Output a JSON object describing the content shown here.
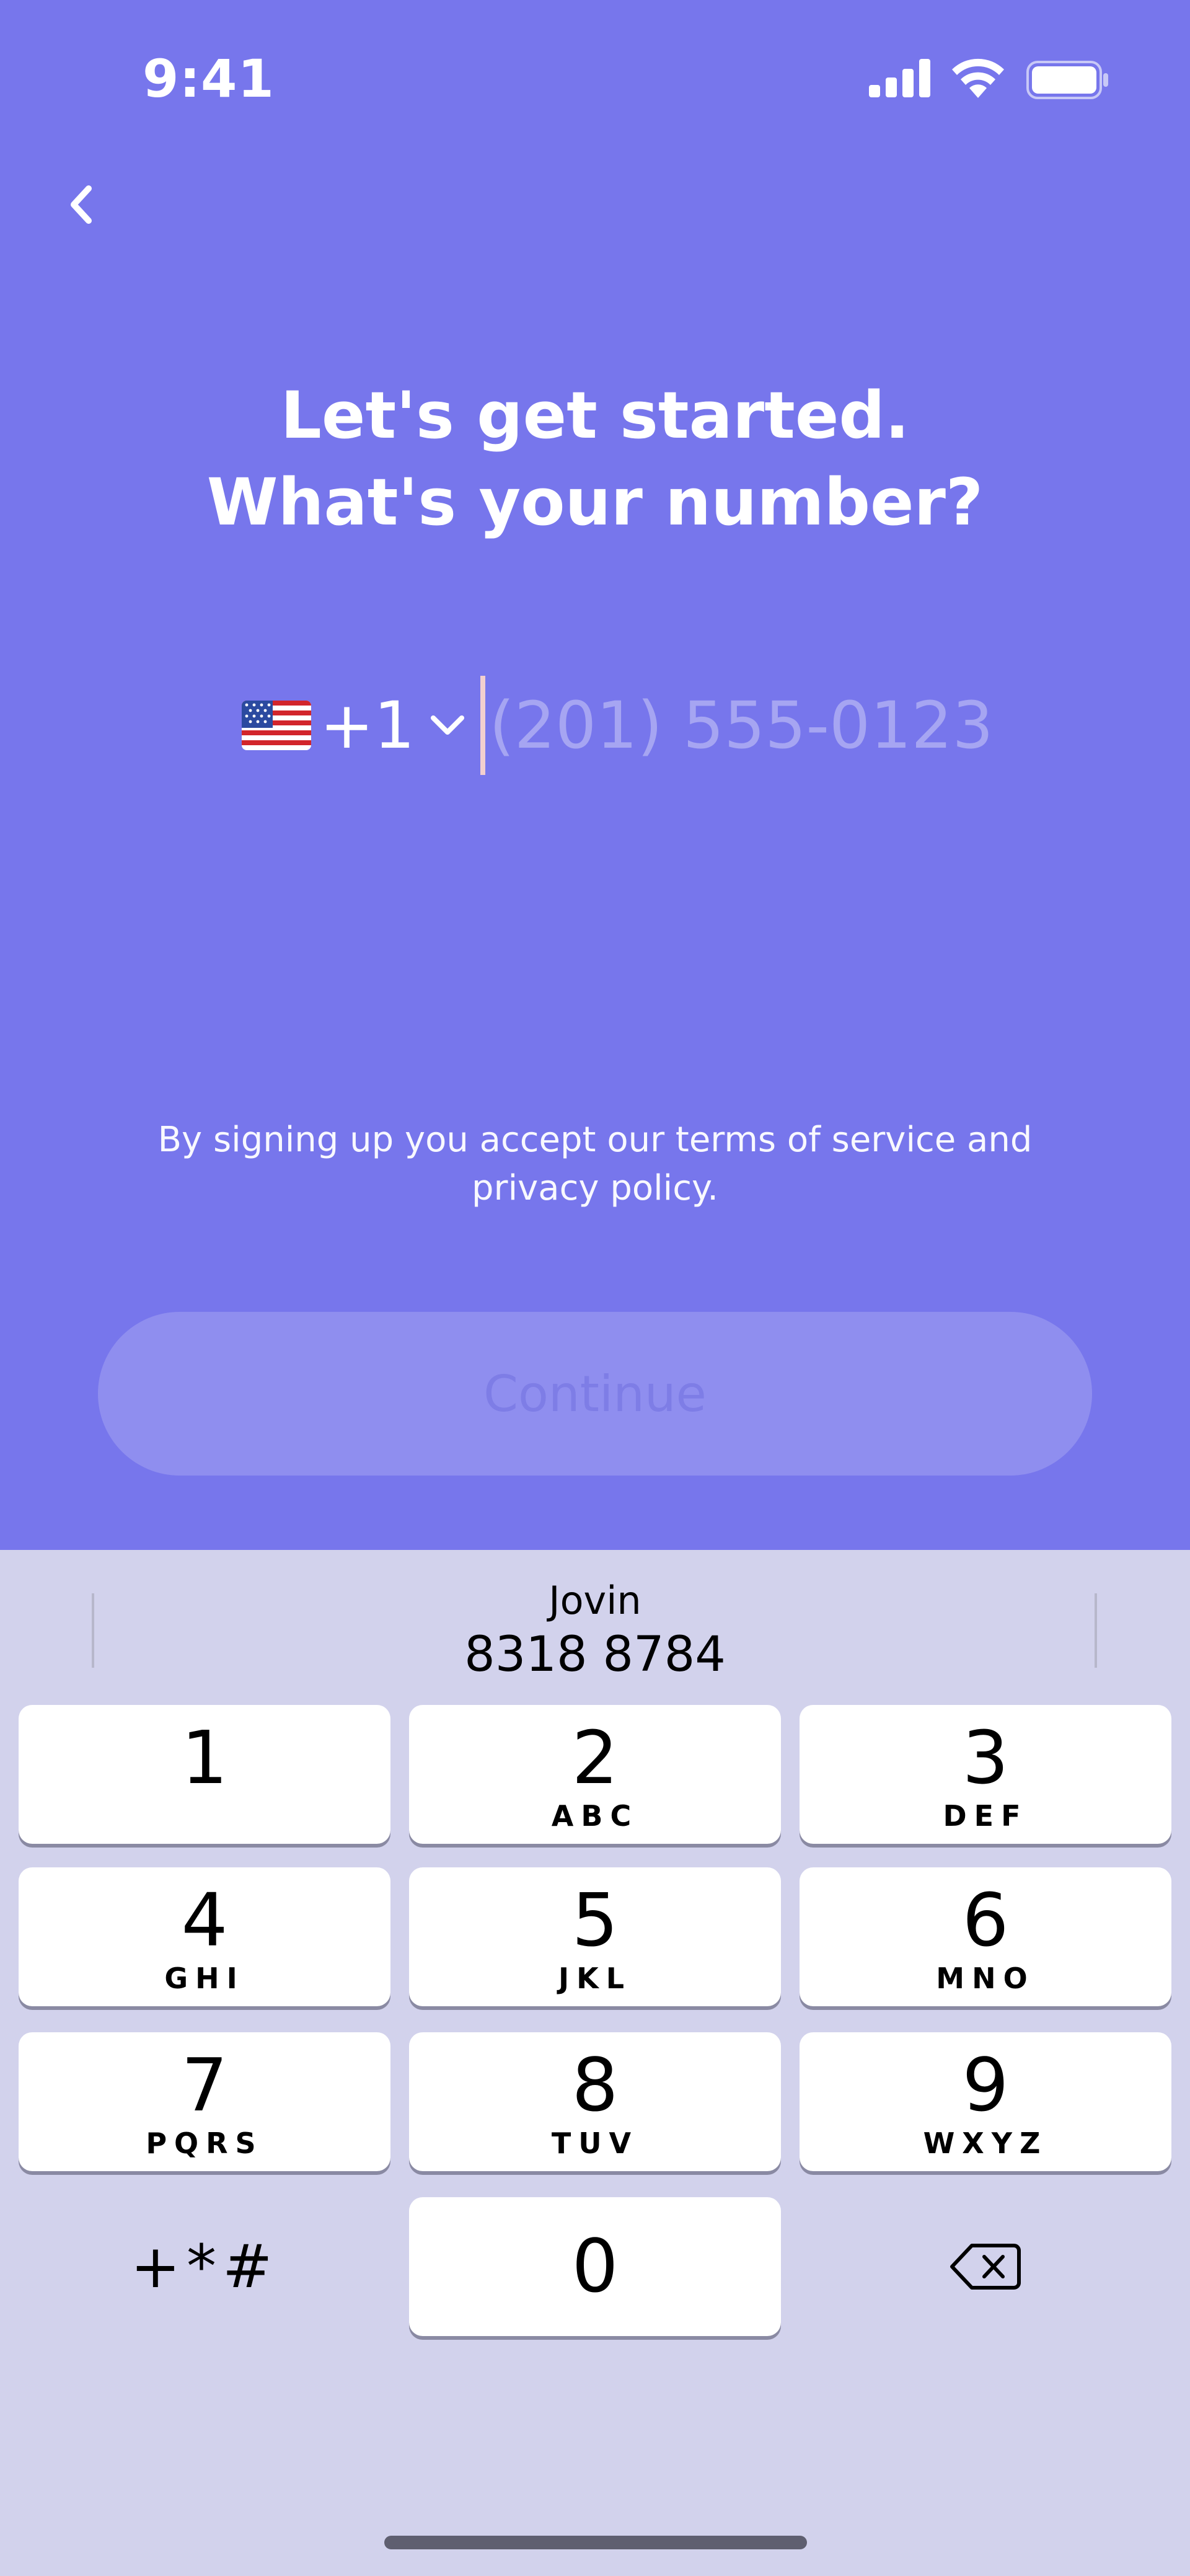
{
  "status_bar": {
    "time": "9:41",
    "icons": [
      "cellular-signal-icon",
      "wifi-icon",
      "battery-icon"
    ]
  },
  "nav": {
    "back_icon": "chevron-left-icon"
  },
  "headline": "Let's get started. What's your number?",
  "phone": {
    "country_flag": "us-flag-icon",
    "dial_code": "+1",
    "dropdown_icon": "chevron-down-icon",
    "value": "",
    "placeholder": "(201) 555-0123"
  },
  "terms": {
    "prefix": "By signing up you accept our ",
    "tos": "terms of service",
    "mid": " and ",
    "privacy": "privacy policy",
    "suffix": "."
  },
  "continue_label": "Continue",
  "keyboard": {
    "suggestion": {
      "name": "Jovin",
      "number": "8318 8784"
    },
    "keys": [
      {
        "digit": "1",
        "letters": ""
      },
      {
        "digit": "2",
        "letters": "ABC"
      },
      {
        "digit": "3",
        "letters": "DEF"
      },
      {
        "digit": "4",
        "letters": "GHI"
      },
      {
        "digit": "5",
        "letters": "JKL"
      },
      {
        "digit": "6",
        "letters": "MNO"
      },
      {
        "digit": "7",
        "letters": "PQRS"
      },
      {
        "digit": "8",
        "letters": "TUV"
      },
      {
        "digit": "9",
        "letters": "WXYZ"
      },
      {
        "digit": "0",
        "letters": ""
      }
    ],
    "symbols_label": "+*#",
    "delete_icon": "backspace-icon"
  },
  "colors": {
    "background": "#7776ec",
    "keyboard": "#d2d2ec",
    "button": "#8f8eef",
    "caret": "#f2cfcf"
  }
}
